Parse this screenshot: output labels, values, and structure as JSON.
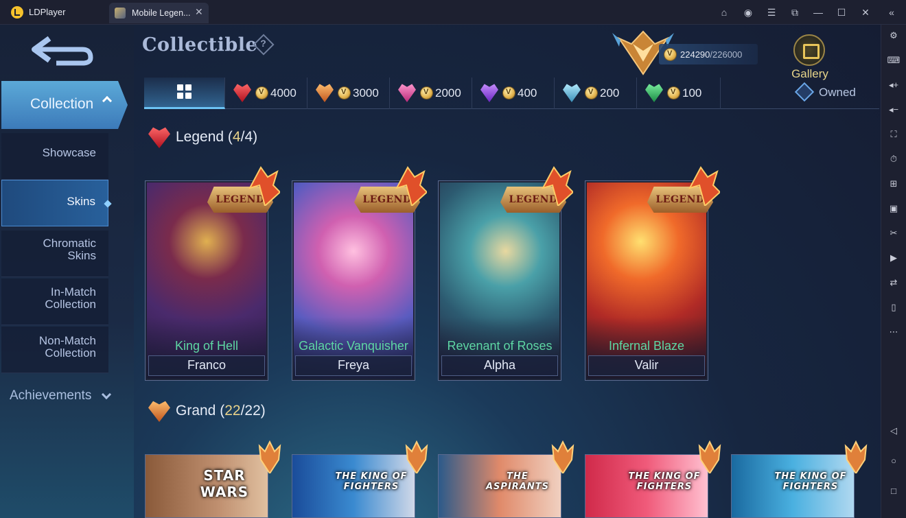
{
  "window": {
    "app_name": "LDPlayer",
    "tab_title": "Mobile Legen...",
    "tab_close": "✕"
  },
  "header": {
    "title": "Collectible",
    "help": "?",
    "currency_current": "224290",
    "currency_max": "/226000",
    "gallery_label": "Gallery"
  },
  "nav": {
    "collection_label": "Collection",
    "sub_items": [
      {
        "label": "Showcase"
      },
      {
        "label": "Skins"
      },
      {
        "label": "Chromatic\nSkins"
      },
      {
        "label": "In-Match\nCollection"
      },
      {
        "label": "Non-Match\nCollection"
      }
    ],
    "achievements_label": "Achievements"
  },
  "filters": [
    {
      "label": "",
      "gem": "grid-icon"
    },
    {
      "label": "4000",
      "gem": "red-gem"
    },
    {
      "label": "3000",
      "gem": "orange-gem"
    },
    {
      "label": "2000",
      "gem": "pink-gem"
    },
    {
      "label": "400",
      "gem": "purple-gem"
    },
    {
      "label": "200",
      "gem": "cyan-gem"
    },
    {
      "label": "100",
      "gem": "green-gem"
    }
  ],
  "owned_label": "Owned",
  "sections": {
    "legend": {
      "name": "Legend",
      "count_open": " (",
      "owned": "4",
      "sep": "/",
      "total": "4",
      "count_close": ")"
    },
    "grand": {
      "name": "Grand",
      "count_open": " (",
      "owned": "22",
      "sep": "/",
      "total": "22",
      "count_close": ")"
    }
  },
  "legend_cards": [
    {
      "skin": "King of Hell",
      "hero": "Franco",
      "tag": "LEGEND"
    },
    {
      "skin": "Galactic Vanquisher",
      "hero": "Freya",
      "tag": "LEGEND"
    },
    {
      "skin": "Revenant of Roses",
      "hero": "Alpha",
      "tag": "LEGEND"
    },
    {
      "skin": "Infernal Blaze",
      "hero": "Valir",
      "tag": "LEGEND"
    }
  ],
  "grand_cards": [
    {
      "logo": "STAR WARS"
    },
    {
      "logo": "THE KING OF FIGHTERS"
    },
    {
      "logo": "THE ASPIRANTS"
    },
    {
      "logo": "THE KING OF FIGHTERS"
    },
    {
      "logo": "THE KING OF FIGHTERS"
    }
  ],
  "colors": {
    "accent": "#6cc3f4",
    "skin_name": "#5ed7a4",
    "gold": "#e8d28a"
  }
}
